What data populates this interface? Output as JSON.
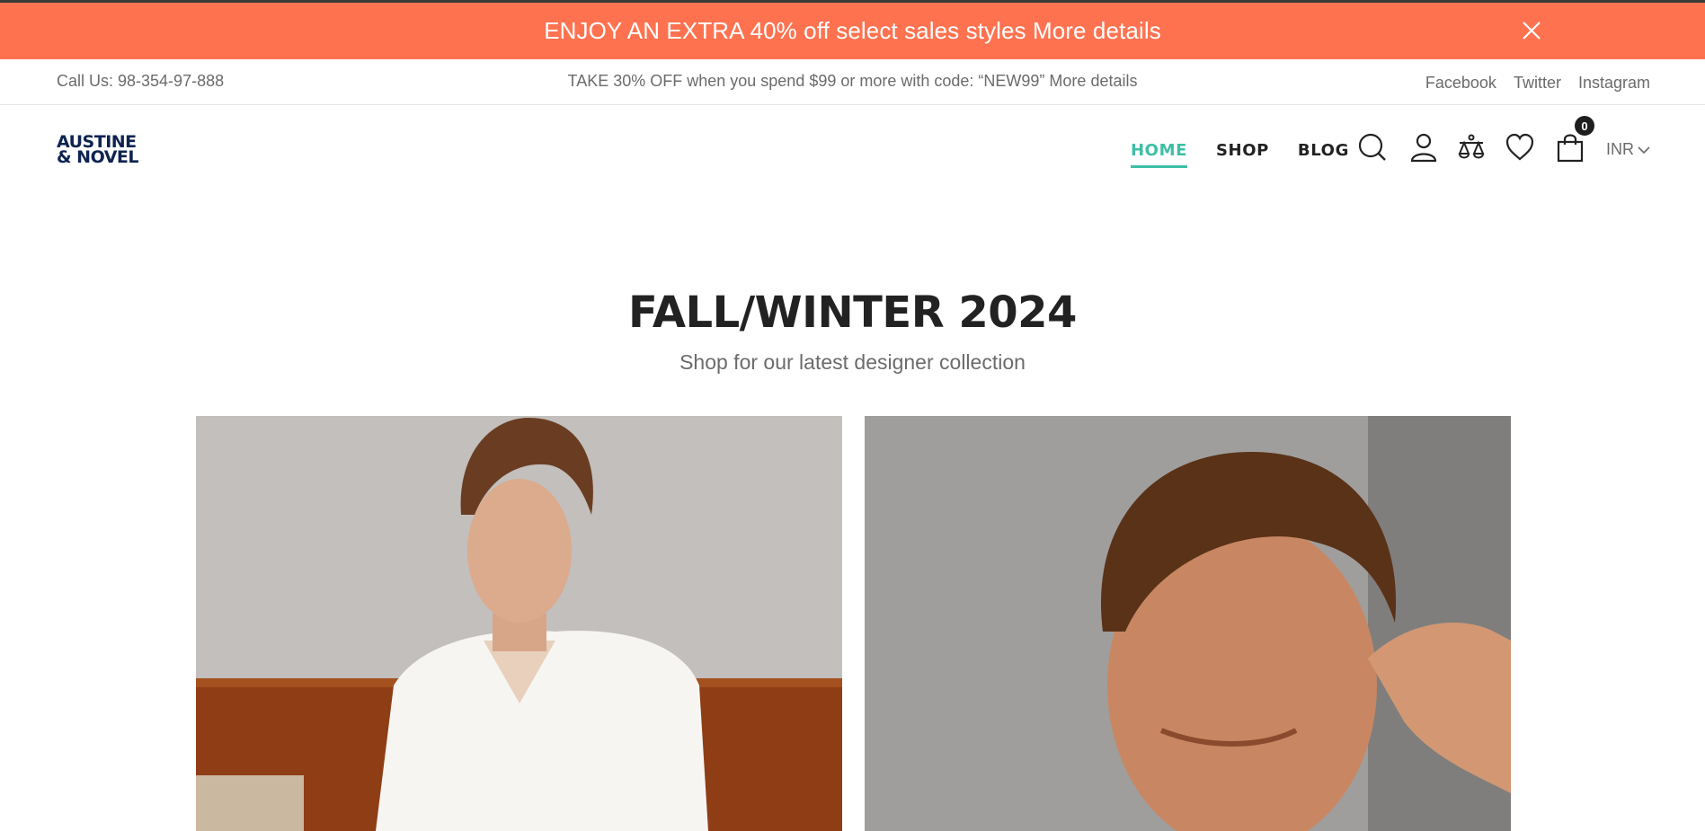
{
  "promo": {
    "text": "ENJOY AN EXTRA 40% off select sales styles More details",
    "close_icon": "close-icon",
    "background": "#ff7250"
  },
  "info": {
    "phone": "Call Us: 98-354-97-888",
    "offer": "TAKE 30% OFF when you spend $99 or more with code: “NEW99” More details",
    "social": [
      "Facebook",
      "Twitter",
      "Instagram"
    ]
  },
  "header": {
    "logo_line1": "AUSTINE",
    "logo_line2": "& NOVEL",
    "nav": [
      "HOME",
      "SHOP",
      "BLOG"
    ],
    "active_nav": "HOME",
    "accent": "#3dbfa6",
    "icons": [
      "search-icon",
      "account-icon",
      "compare-icon",
      "wishlist-icon",
      "cart-icon"
    ],
    "cart_count": "0",
    "currency": "INR"
  },
  "hero": {
    "title": "FALL/WINTER 2024",
    "subtitle": "Shop for our latest designer collection"
  }
}
